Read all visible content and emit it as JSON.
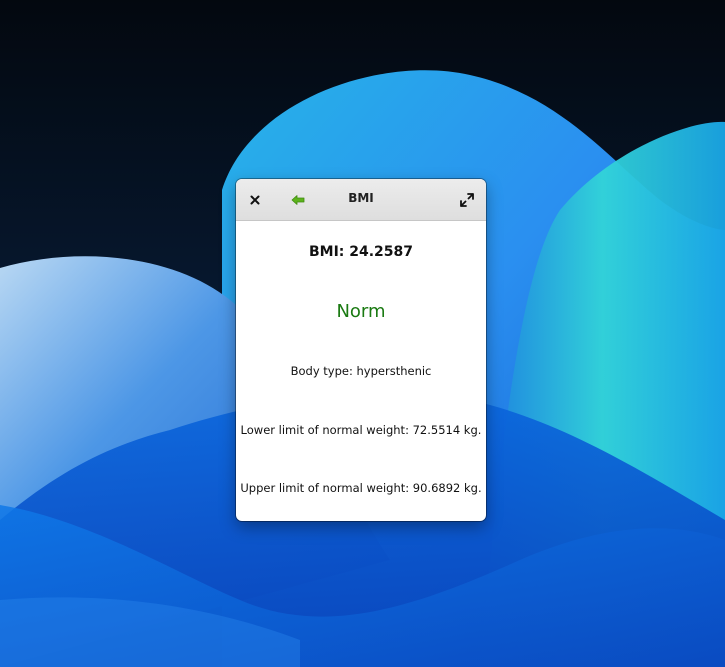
{
  "window": {
    "title": "BMI"
  },
  "result": {
    "bmi_text": "BMI: 24.2587",
    "status": "Norm",
    "body_type_text": "Body type: hypersthenic",
    "lower_limit_text": "Lower limit of normal weight: 72.5514 kg.",
    "upper_limit_text": "Upper limit of normal weight: 90.6892 kg."
  },
  "icons": {
    "close": "close-icon",
    "back": "back-arrow-icon",
    "maximize": "maximize-icon"
  },
  "colors": {
    "status_color": "#1a7a12",
    "back_arrow_color": "#5cb31c",
    "titlebar": "#e4e4e4",
    "desktop_dark": "#061225",
    "wallpaper_blue": "#0a63d8",
    "wallpaper_cyan": "#2fd0d6"
  }
}
